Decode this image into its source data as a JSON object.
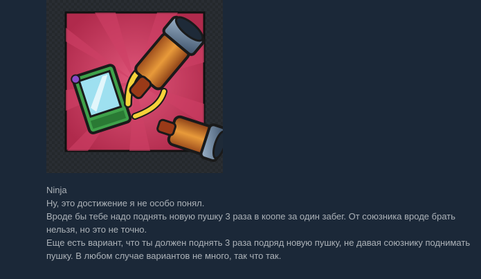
{
  "achievement": {
    "icon": "weapon-swap-icon"
  },
  "comment": {
    "author": "Ninja",
    "lines": [
      "Ну, это достижение я не особо понял.",
      "Вроде бы тебе надо поднять новую пушку 3 раза в коопе за один забег. От союзника вроде брать нельзя, но это не точно.",
      "Еще есть вариант, что ты должен поднять 3 раза подряд новую пушку, не давая союзнику поднимать пушку. В любом случае вариантов не много, так что так."
    ]
  },
  "colors": {
    "background": "#1b2838",
    "text": "#acb2b8",
    "icon_bg": "#c9365a"
  }
}
